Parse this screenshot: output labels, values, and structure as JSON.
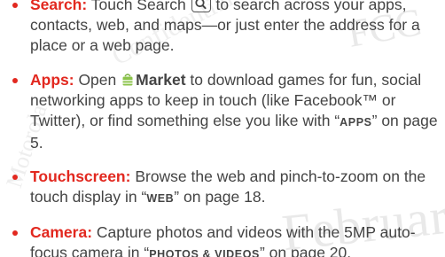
{
  "watermark": {
    "big": "February",
    "top": "FCC",
    "mid": "Confidential",
    "left": "Motorola"
  },
  "items": [
    {
      "label": "Search:",
      "text_a": " Touch Search ",
      "icon": "search-key-icon",
      "text_b": " to search across your apps, contacts, web, and maps—or just enter the address for a place or a web page."
    },
    {
      "label": "Apps:",
      "text_a": " Open ",
      "icon": "market-app-icon",
      "bold": "Market",
      "text_b": " to download games for fun, social networking apps to keep in touch (like Facebook™ or Twitter), or find something else you like with “",
      "ref": "APPS",
      "text_c": "” on page 5."
    },
    {
      "label": "Touchscreen:",
      "text_a": " Browse the web and pinch-to-zoom on the touch display in “",
      "ref": "WEB",
      "text_b": "” on page 18."
    },
    {
      "label": "Camera:",
      "text_a": " Capture photos and videos with the 5MP auto-focus camera in “",
      "ref": "PHOTOS & VIDEOS",
      "text_b": "” on page 20."
    }
  ],
  "colors": {
    "accent": "#e2281f",
    "body_text": "#444444",
    "market_icon": "#7cb342"
  }
}
